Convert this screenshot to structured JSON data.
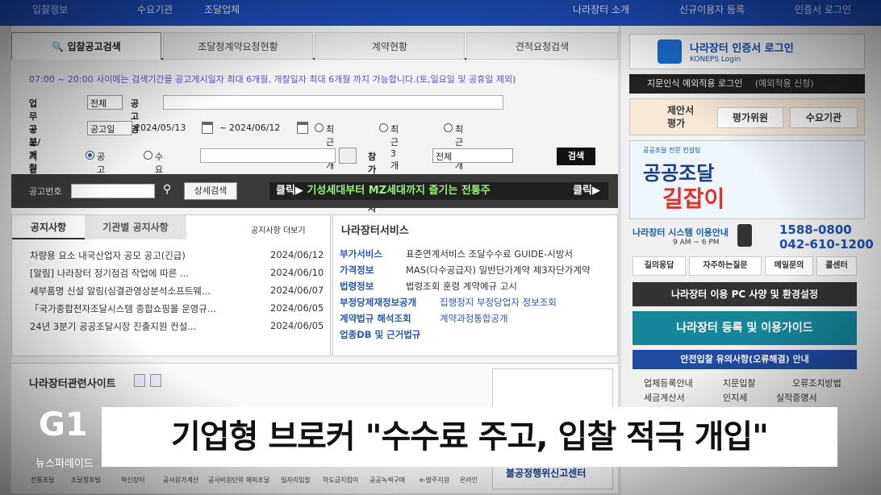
{
  "topnav": {
    "items": [
      "입찰정보",
      "수요기관",
      "조달업체",
      "나라장터 소개",
      "신규이용자 등록",
      "인증서 로그인"
    ]
  },
  "tabs": [
    "입찰공고검색",
    "조달청계약요청현황",
    "계약현황",
    "견적요청검색"
  ],
  "notice": "07:00 ~ 20:00 사이에는 검색기간을 공고게시일자 최대 6개월, 개찰일자 최대 6개월 까지 가능합니다.(토,일요일 및 공휴일 제외)",
  "search": {
    "biz_label": "업무구분",
    "biz_value": "전체",
    "title_label": "공고명",
    "date_label": "공고/개찰일",
    "date_type": "공고일",
    "date_from": "2024/05/13",
    "date_tilde": "~",
    "date_to": "2024/06/12",
    "range_options": [
      "최근1개월",
      "최근3개월",
      "최근6개월"
    ],
    "org_label": "기관명",
    "org_options": [
      "공고기관",
      "수요기관"
    ],
    "region_label": "참가제한지역",
    "region_value": "전체",
    "search_btn": "검색",
    "bid_no_label": "공고번호",
    "detail_btn": "상세검색"
  },
  "banner": {
    "click1": "클릭▶",
    "text": "기성세대부터 MZ세대까지 즐기는 전통주",
    "click2": "클릭▶"
  },
  "notices": {
    "tab_active": "공지사항",
    "tab_other": "기관별 공지사항",
    "more": "공지사항 더보기",
    "rows": [
      {
        "title": "차량용 요소 내국산업자 공모 공고(긴급)",
        "date": "2024/06/12"
      },
      {
        "title": "[알림] 나라장터 정기점검 작업에 따른 ...",
        "date": "2024/06/10"
      },
      {
        "title": "세부품명 신설 알림(심결관영상분석소프트웨...",
        "date": "2024/06/07"
      },
      {
        "title": "「국가종합전자조달시스템 종합쇼핑몰 운영규...",
        "date": "2024/06/05"
      },
      {
        "title": "24년 3분기 공공조달시장 진출지원 컨설...",
        "date": "2024/06/05"
      }
    ]
  },
  "services": {
    "title": "나라장터서비스",
    "rows": [
      {
        "key": "부가서비스",
        "val": "표준연계서비스 조달수수료 GUIDE-시방서"
      },
      {
        "key": "가격정보",
        "val": "MAS(다수공급자) 일반단가계약 제3자단가계약"
      },
      {
        "key": "법령정보",
        "val": "법령조회 훈령 계약예규 고시"
      },
      {
        "key": "부정당제재정보공개",
        "val": "집행정지 부정당업자 정보조회"
      },
      {
        "key": "계약법규 해석조회",
        "val": "계약과정통합공개"
      },
      {
        "key": "업종DB 및 근거법규",
        "val": ""
      }
    ]
  },
  "related": {
    "title": "나라장터관련사이트",
    "bottom_links": [
      "전통조달",
      "조달청포털",
      "혁신장터",
      "공사원가계산",
      "공사비원단위 해외조달",
      "일자리입찰",
      "하도급지킴이",
      "공공녹색구매",
      "e-발주지원",
      "온라인"
    ]
  },
  "right": {
    "login_title": "나라장터 인증서 로그인",
    "login_sub": "KONEPS Login",
    "fingerprint": "지문인식 예외적용 로그인",
    "fingerprint_tag": "(예외적용 신청)",
    "eval_label": "제안서 평가",
    "eval_a": "평가위원",
    "eval_b": "수요기관",
    "ad_small": "공공조달 전문 컨설팅",
    "ad_line1": "공공조달",
    "ad_line2": "길잡이",
    "system_info": "나라장터 시스템 이용안내",
    "hours": "9 AM ~ 6 PM",
    "phone1": "1588-0800",
    "phone2": "042-610-1200",
    "help": [
      "길의응답",
      "자주하는질문",
      "메일문의",
      "콜센터"
    ],
    "pc_btn": "나라장터 이용 PC 사양 및 환경설정",
    "guide_btn": "나라장터 등록 및 이용가이드",
    "safety_btn": "안전입찰 유의사항(오류해결) 안내",
    "links": [
      "업체등록안내",
      "지문입찰",
      "오류조치방법",
      "세금계산서",
      "인지세",
      "실적증명서"
    ],
    "report": "불공정행위신고센터"
  },
  "caption": "기업형 브로커 \"수수료 주고, 입찰 적극 개입\"",
  "channel": {
    "logo": "G1",
    "program": "뉴스퍼레이드"
  }
}
